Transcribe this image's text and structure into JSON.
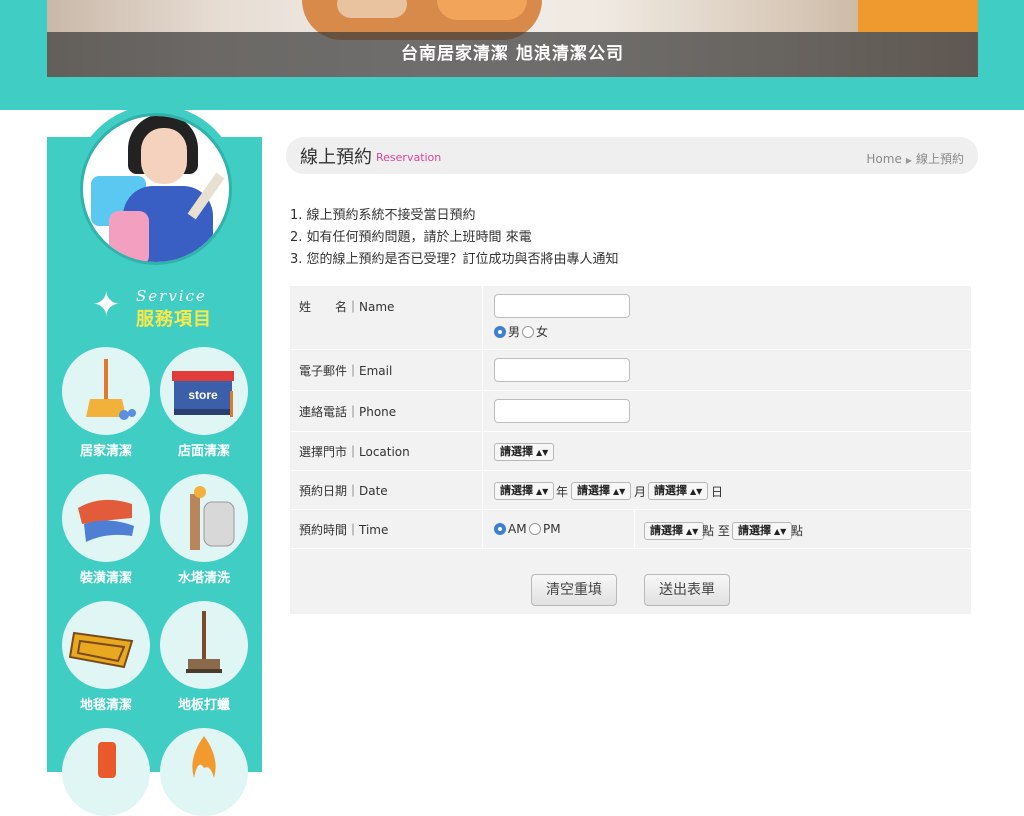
{
  "banner": {
    "caption": "台南居家清潔 旭浪清潔公司"
  },
  "sidebar": {
    "service_en": "Service",
    "service_zh": "服務項目",
    "items": [
      {
        "label": "居家清潔",
        "icon": "broom-icon"
      },
      {
        "label": "店面清潔",
        "icon": "store-icon",
        "icon_text": "store"
      },
      {
        "label": "裝潢清潔",
        "icon": "gloves-icon"
      },
      {
        "label": "水塔清洗",
        "icon": "water-tank-icon"
      },
      {
        "label": "地毯清潔",
        "icon": "carpet-icon"
      },
      {
        "label": "地板打蠟",
        "icon": "floor-brush-icon"
      }
    ]
  },
  "page": {
    "title": "線上預約",
    "subtitle": "Reservation",
    "breadcrumb": {
      "home": "Home",
      "current": "線上預約"
    }
  },
  "notes": [
    "1. 線上預約系統不接受當日預約",
    "2. 如有任何預約問題，請於上班時間 來電",
    "3. 您的線上預約是否已受理？訂位成功與否將由專人通知"
  ],
  "form": {
    "name_label": "姓　　名｜Name",
    "name_value": "",
    "gender": {
      "male": "男",
      "female": "女",
      "selected": "男"
    },
    "email_label": "電子郵件｜Email",
    "email_value": "",
    "phone_label": "連絡電話｜Phone",
    "phone_value": "",
    "location_label": "選擇門市｜Location",
    "location_select": "請選擇",
    "date_label": "預約日期｜Date",
    "year_select": "請選擇",
    "year_unit": "年",
    "month_select": "請選擇",
    "month_unit": "月",
    "day_select": "請選擇",
    "day_unit": "日",
    "time_label": "預約時間｜Time",
    "ampm": {
      "am": "AM",
      "pm": "PM",
      "selected": "AM"
    },
    "time_from_select": "請選擇",
    "time_from_unit": "點 至",
    "time_to_select": "請選擇",
    "time_to_unit": "點",
    "reset_button": "清空重填",
    "submit_button": "送出表單"
  },
  "colors": {
    "teal": "#40cdc4",
    "accent_pink": "#e0449a",
    "service_yellow": "#f7e94a"
  }
}
